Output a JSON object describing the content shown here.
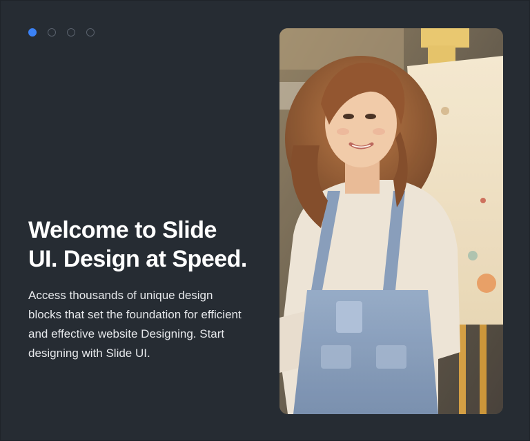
{
  "carousel": {
    "slides": [
      {
        "label": "Slide 1",
        "active": true
      },
      {
        "label": "Slide 2",
        "active": false
      },
      {
        "label": "Slide 3",
        "active": false
      },
      {
        "label": "Slide 4",
        "active": false
      }
    ]
  },
  "hero": {
    "title": "Welcome to Slide UI. Design at Speed.",
    "description": "Access thousands of unique design blocks that set the foundation for efficient and effective website Designing. Start designing with Slide UI."
  },
  "image": {
    "alt": "Smiling young woman with curly hair wearing denim overalls standing beside a painting easel"
  },
  "colors": {
    "background": "#262c33",
    "accent": "#3b82f6",
    "dot_inactive": "#5a626d",
    "text_primary": "#ffffff",
    "text_secondary": "#e6e8eb"
  }
}
